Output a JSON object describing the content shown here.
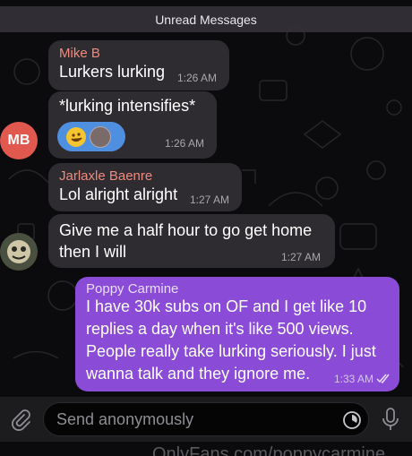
{
  "banner": {
    "label": "Unread Messages"
  },
  "messages": [
    {
      "sender": "Mike B",
      "text": "Lurkers lurking",
      "time": "1:26 AM"
    },
    {
      "text": "*lurking intensifies*",
      "time": "1:26 AM"
    },
    {
      "sender": "Jarlaxle Baenre",
      "text": "Lol alright alright",
      "time": "1:27 AM"
    },
    {
      "line1": "Give me a half hour to go get home",
      "line2": "then I will",
      "time": "1:27 AM"
    },
    {
      "sender": "Poppy Carmine",
      "lines": [
        "I have 30k subs on OF and I get like 10",
        "replies a day when it's like 500 views.",
        "People really take lurking seriously. I just",
        "wanna talk and they ignore me."
      ],
      "time": "1:33 AM"
    }
  ],
  "avatars": {
    "mike_initials": "MB"
  },
  "input": {
    "placeholder": "Send anonymously"
  },
  "watermark": {
    "text": "OnlyFans.com/poppycarmine"
  },
  "colors": {
    "mike_name": "#f08a7e",
    "jarlaxle_name": "#f08a7e",
    "outgoing_bubble": "#8a4bd6",
    "incoming_bubble": "#2e2c30",
    "mb_avatar": "#e0584e"
  },
  "icons": [
    "paperclip-icon",
    "timer-icon",
    "microphone-icon",
    "double-check-icon"
  ]
}
